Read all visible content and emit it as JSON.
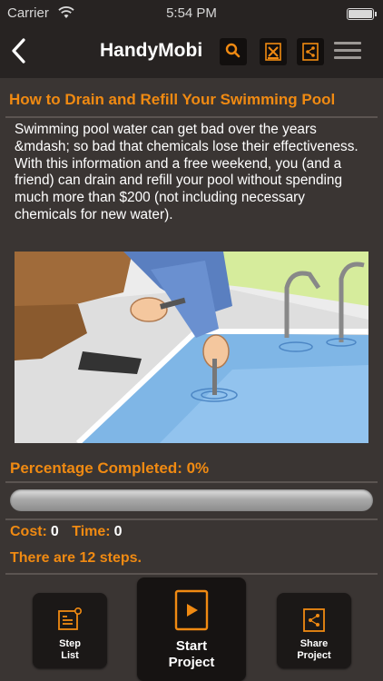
{
  "status_bar": {
    "carrier": "Carrier",
    "time": "5:54 PM"
  },
  "nav": {
    "title": "HandyMobi",
    "icons": [
      "back-chevron-icon",
      "search-icon",
      "tools-icon",
      "share-icon",
      "menu-icon"
    ]
  },
  "article": {
    "title": "How to Drain and Refill Your Swimming Pool",
    "description": "Swimming pool water can get bad over the years &mdash; so bad that chemicals lose their effectiveness. With this information and a free weekend, you (and a friend) can drain and refill your pool without spending much more than $200 (not including necessary chemicals for new water)."
  },
  "progress": {
    "label": "Percentage Completed: 0%",
    "fraction": 0
  },
  "stats": {
    "cost_label": "Cost:",
    "cost_value": "0",
    "time_label": "Time:",
    "time_value": "0"
  },
  "steps_text": "There are 12 steps.",
  "buttons": {
    "step_list": {
      "line1": "Step",
      "line2": "List"
    },
    "start_project": {
      "line1": "Start",
      "line2": "Project"
    },
    "share_project": {
      "line1": "Share",
      "line2": "Project"
    }
  },
  "colors": {
    "accent": "#f08a12",
    "background": "#3a3533",
    "bar": "#272322"
  }
}
